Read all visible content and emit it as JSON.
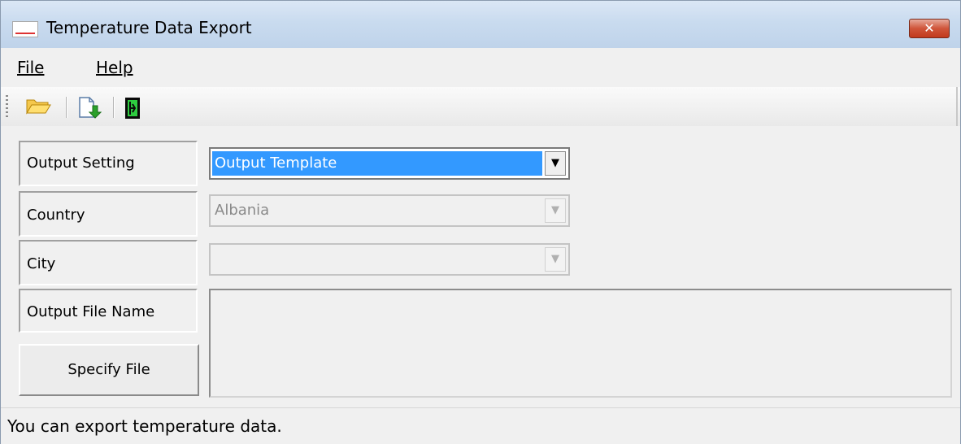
{
  "window": {
    "title": "Temperature Data Export",
    "app_icon": "app-logo-icon",
    "close_icon": "close-x-icon",
    "close_glyph": "✕"
  },
  "menu": {
    "file": "File",
    "help": "Help"
  },
  "toolbar": {
    "icons": [
      "open-folder-icon",
      "export-document-icon",
      "exit-door-icon"
    ]
  },
  "form": {
    "output_setting_label": "Output Setting",
    "output_setting_value": "Output Template",
    "country_label": "Country",
    "country_value": "Albania",
    "city_label": "City",
    "city_value": "",
    "output_file_name_label": "Output File Name",
    "output_file_name_value": "",
    "specify_file_button": "Specify File"
  },
  "status": {
    "text": "You can export temperature data."
  },
  "colors": {
    "selection": "#3399ff",
    "close_button": "#c1391d",
    "titlebar": "#c9dbef"
  }
}
